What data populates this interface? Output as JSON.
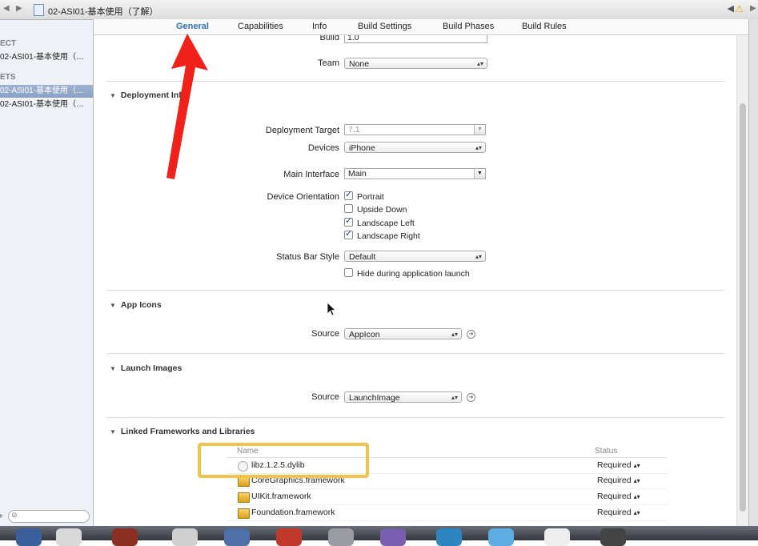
{
  "jumpbar": {
    "back_arrow": "◀",
    "forward_arrow": "▶",
    "breadcrumb": "02-ASI01-基本使用（了解）",
    "right_controls": "◀",
    "warning_glyph": "⚠",
    "right_arrow": "▶"
  },
  "tabs": [
    {
      "label": "General",
      "active": true
    },
    {
      "label": "Capabilities"
    },
    {
      "label": "Info"
    },
    {
      "label": "Build Settings"
    },
    {
      "label": "Build Phases"
    },
    {
      "label": "Build Rules"
    }
  ],
  "sidebar": {
    "project_header": "ECT",
    "project_item": "02-ASI01-基本使用（…",
    "targets_header": "ETS",
    "target_items": [
      "02-ASI01-基本使用（…",
      "02-ASI01-基本使用（…"
    ],
    "add_glyph": "+",
    "filter_glyph": "⊝"
  },
  "identity": {
    "build_label": "Build",
    "build_value": "1.0",
    "team_label": "Team",
    "team_value": "None"
  },
  "deployment": {
    "title": "Deployment Info",
    "target_label": "Deployment Target",
    "target_value": "7.1",
    "devices_label": "Devices",
    "devices_value": "iPhone",
    "main_interface_label": "Main Interface",
    "main_interface_value": "Main",
    "orientation_label": "Device Orientation",
    "orientations": [
      {
        "label": "Portrait",
        "checked": true
      },
      {
        "label": "Upside Down",
        "checked": false
      },
      {
        "label": "Landscape Left",
        "checked": true
      },
      {
        "label": "Landscape Right",
        "checked": true
      }
    ],
    "status_bar_label": "Status Bar Style",
    "status_bar_value": "Default",
    "hide_launch_label": "Hide during application launch",
    "hide_launch_checked": false
  },
  "app_icons": {
    "title": "App Icons",
    "source_label": "Source",
    "source_value": "AppIcon"
  },
  "launch_images": {
    "title": "Launch Images",
    "source_label": "Source",
    "source_value": "LaunchImage"
  },
  "frameworks": {
    "title": "Linked Frameworks and Libraries",
    "col_name": "Name",
    "col_status": "Status",
    "rows": [
      {
        "name": "libz.1.2.5.dylib",
        "kind": "dylib",
        "status": "Required"
      },
      {
        "name": "CoreGraphics.framework",
        "kind": "framework",
        "status": "Required"
      },
      {
        "name": "UIKit.framework",
        "kind": "framework",
        "status": "Required"
      },
      {
        "name": "Foundation.framework",
        "kind": "framework",
        "status": "Required"
      }
    ]
  },
  "glyphs": {
    "updown": "▴▾",
    "combo_down": "▼",
    "disclosure": "▼",
    "go_arrow": "➔"
  },
  "colors": {
    "accent": "#2f6fb5",
    "highlight": "#f3c24b",
    "annotation_arrow": "#f0211b"
  }
}
